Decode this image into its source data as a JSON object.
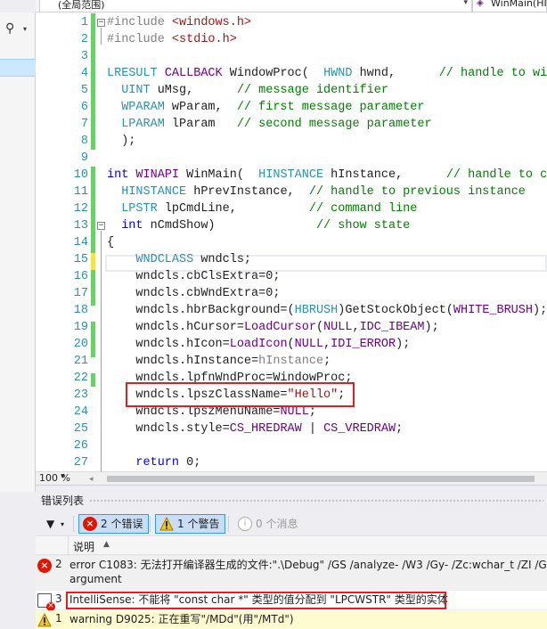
{
  "nav": {
    "scope_label": "(全局范围)",
    "member_label": "WinMain(HINSTANCE"
  },
  "editor": {
    "line_numbers": [
      "1",
      "2",
      "3",
      "4",
      "5",
      "6",
      "7",
      "8",
      "9",
      "10",
      "11",
      "12",
      "13",
      "14",
      "15",
      "16",
      "17",
      "18",
      "19",
      "20",
      "21",
      "22",
      "23",
      "24",
      "25",
      "26",
      "27"
    ],
    "zoom": "100 %"
  },
  "error_list": {
    "title": "错误列表",
    "errors_btn": "2 个错误",
    "warnings_btn": "1 个警告",
    "messages_btn": "0 个消息",
    "column_description": "说明",
    "rows": [
      {
        "num": "2",
        "text": "error C1083: 无法打开编译器生成的文件:\".\\Debug\" /GS /analyze- /W3 /Gy- /Zc:wchar_t /ZI /Gm",
        "text2": "argument"
      },
      {
        "num": "3",
        "text": "IntelliSense: 不能将 \"const char *\" 类型的值分配到 \"LPCWSTR\" 类型的实体"
      },
      {
        "num": "1",
        "text": "warning D9025: 正在重写\"/MDd\"(用\"/MTd\")"
      }
    ]
  },
  "colors": {
    "keyword": "#0000ff",
    "type": "#2b91af",
    "macro": "#6f008a",
    "comment": "#008000",
    "string": "#a31515",
    "highlight_box": "#e02020"
  }
}
